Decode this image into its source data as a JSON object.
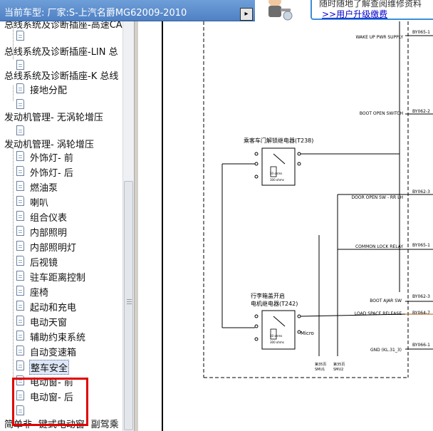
{
  "header": {
    "vehicle_title": "当前车型:  厂家:S-上汽名爵MG62009-2010",
    "dropdown_glyph": "▸"
  },
  "banner": {
    "line1": "随时随地了解查阅维修资料",
    "line2": ">>用户升级缴费"
  },
  "tree": {
    "items": [
      {
        "label": "总线系统及诊断插座-高速CA"
      },
      {
        "label": "总线系统及诊断插座-LIN 总"
      },
      {
        "label": "总线系统及诊断插座-K 总线"
      },
      {
        "label": "接地分配"
      },
      {
        "label": "发动机管理- 无涡轮增压"
      },
      {
        "label": "发动机管理- 涡轮增压"
      },
      {
        "label": "外饰灯- 前"
      },
      {
        "label": "外饰灯- 后"
      },
      {
        "label": "燃油泵"
      },
      {
        "label": "喇叭"
      },
      {
        "label": "组合仪表"
      },
      {
        "label": "内部照明"
      },
      {
        "label": "内部照明灯"
      },
      {
        "label": "后视镜"
      },
      {
        "label": "驻车距离控制"
      },
      {
        "label": "座椅"
      },
      {
        "label": "起动和充电"
      },
      {
        "label": "电动天窗"
      },
      {
        "label": "辅助约束系统"
      },
      {
        "label": "自动变速箱"
      },
      {
        "label": "整车安全"
      },
      {
        "label": "电动窗- 前"
      },
      {
        "label": "电动窗- 后"
      },
      {
        "label": "简单非- 键式电动窗- 副驾乘"
      }
    ]
  },
  "diagram": {
    "signals": [
      "WAKE UP PWR SUPPLY",
      "BOOT OPEN SWITCH",
      "DOOR OPEN SW - RR LH",
      "COMMON LOCK RELAY",
      "BOOT AJAR SW",
      "LOAD SPACE RELEASE",
      "GND (KL.31_3)"
    ],
    "pins": [
      "BY065-1",
      "BY062-2",
      "BY062-3",
      "BY065-1",
      "BY062-3",
      "BY064-7",
      "BY066-1"
    ],
    "relay1": {
      "label": "乘客车门解锁继电器(T238)",
      "sub1": "50 ohms",
      "sub2": "300 ohms"
    },
    "relay2": {
      "label1": "行李箱盖开启",
      "label2": "电机继电器(T242)",
      "sub1": "50 ohms",
      "sub2": "300 ohms"
    },
    "micro_label": "Micro",
    "refs": [
      {
        "line1": "第35页",
        "line2": "SMU1"
      },
      {
        "line1": "第35页",
        "line2": "SMU2"
      }
    ]
  }
}
